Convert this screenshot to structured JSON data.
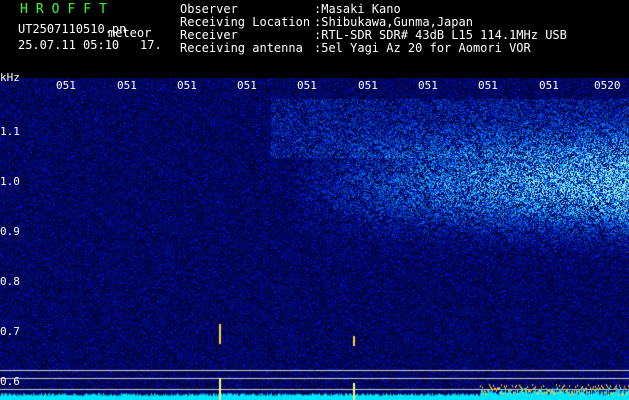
{
  "header": {
    "brand": "HROFFT",
    "filename": "UT2507110510.pn",
    "mode": "meteor",
    "datetime": "25.07.11 05:10",
    "extra": "17.",
    "fields": [
      {
        "label": "Observer",
        "value": ":Masaki Kano"
      },
      {
        "label": "Receiving Location",
        "value": ":Shibukawa,Gunma,Japan"
      },
      {
        "label": "Receiver",
        "value": ":RTL-SDR SDR# 43dB L15 114.1MHz USB"
      },
      {
        "label": "Receiving antenna",
        "value": ":5el Yagi Az 20 for Aomori VOR"
      }
    ]
  },
  "axis": {
    "unit": "kHz",
    "y_ticks": [
      "1.1",
      "1.0",
      "0.9",
      "0.8",
      "0.7",
      "0.6"
    ],
    "x_ticks": [
      "051",
      "051",
      "051",
      "051",
      "051",
      "051",
      "051",
      "051",
      "051",
      "0520"
    ]
  },
  "colors": {
    "background": "#000000",
    "brand": "#33ff33",
    "text": "#ffffff",
    "noise": "#0a1a6e",
    "signal": "#2bd3ff",
    "baseline": "#00ffff",
    "echo": "#ffff66"
  }
}
